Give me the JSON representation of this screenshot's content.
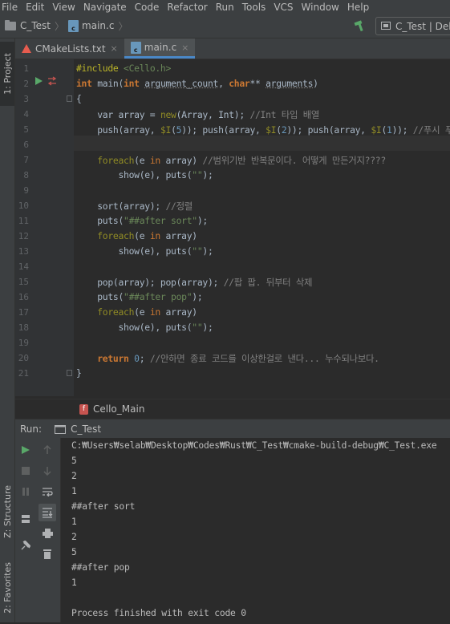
{
  "menu": [
    "File",
    "Edit",
    "View",
    "Navigate",
    "Code",
    "Refactor",
    "Run",
    "Tools",
    "VCS",
    "Window",
    "Help"
  ],
  "nav": {
    "project": "C_Test",
    "file": "main.c",
    "run_config": "C_Test | Deb"
  },
  "left_strip": {
    "project_tab": "1: Project",
    "structure_tab": "Z: Structure",
    "favorites_tab": "2: Favorites"
  },
  "tabs": [
    {
      "label": "CMakeLists.txt",
      "close": "×"
    },
    {
      "label": "main.c",
      "close": "×"
    }
  ],
  "editor": {
    "line_numbers": [
      "1",
      "2",
      "3",
      "4",
      "5",
      "6",
      "7",
      "8",
      "9",
      "10",
      "11",
      "12",
      "13",
      "14",
      "15",
      "16",
      "17",
      "18",
      "19",
      "20",
      "21"
    ],
    "function_breadcrumb": "Cello_Main",
    "lines": [
      [
        {
          "t": "#include ",
          "c": "inc"
        },
        {
          "t": "<Cello.h>",
          "c": "str"
        }
      ],
      [
        {
          "t": "int ",
          "c": "kw"
        },
        {
          "t": "main(",
          "c": ""
        },
        {
          "t": "int ",
          "c": "kw"
        },
        {
          "t": "argument_count",
          "c": "param"
        },
        {
          "t": ", ",
          "c": ""
        },
        {
          "t": "char",
          "c": "kw"
        },
        {
          "t": "** ",
          "c": ""
        },
        {
          "t": "arguments",
          "c": "param"
        },
        {
          "t": ")",
          "c": ""
        }
      ],
      [
        {
          "t": "{",
          "c": ""
        }
      ],
      [
        {
          "t": "    var array = ",
          "c": ""
        },
        {
          "t": "new",
          "c": "mac"
        },
        {
          "t": "(Array, Int); ",
          "c": ""
        },
        {
          "t": "//Int 타입 배열",
          "c": "cm"
        }
      ],
      [
        {
          "t": "    push(array, ",
          "c": ""
        },
        {
          "t": "$I",
          "c": "mac"
        },
        {
          "t": "(",
          "c": ""
        },
        {
          "t": "5",
          "c": "num"
        },
        {
          "t": ")); push(array, ",
          "c": ""
        },
        {
          "t": "$I",
          "c": "mac"
        },
        {
          "t": "(",
          "c": ""
        },
        {
          "t": "2",
          "c": "num"
        },
        {
          "t": ")); push(array, ",
          "c": ""
        },
        {
          "t": "$I",
          "c": "mac"
        },
        {
          "t": "(",
          "c": ""
        },
        {
          "t": "1",
          "c": "num"
        },
        {
          "t": ")); ",
          "c": ""
        },
        {
          "t": "//푸시 푸시",
          "c": "cm"
        }
      ],
      [],
      [
        {
          "t": "    ",
          "c": ""
        },
        {
          "t": "foreach",
          "c": "mac"
        },
        {
          "t": "(e ",
          "c": ""
        },
        {
          "t": "in",
          "c": "kwn"
        },
        {
          "t": " array) ",
          "c": ""
        },
        {
          "t": "//범위기반 반복문이다. 어떻게 만든거지????",
          "c": "cm"
        }
      ],
      [
        {
          "t": "        show(e), puts(",
          "c": ""
        },
        {
          "t": "\"\"",
          "c": "str"
        },
        {
          "t": ");",
          "c": ""
        }
      ],
      [],
      [
        {
          "t": "    sort(array); ",
          "c": ""
        },
        {
          "t": "//정렬",
          "c": "cm"
        }
      ],
      [
        {
          "t": "    puts(",
          "c": ""
        },
        {
          "t": "\"##after sort\"",
          "c": "str"
        },
        {
          "t": ");",
          "c": ""
        }
      ],
      [
        {
          "t": "    ",
          "c": ""
        },
        {
          "t": "foreach",
          "c": "mac"
        },
        {
          "t": "(e ",
          "c": ""
        },
        {
          "t": "in",
          "c": "kwn"
        },
        {
          "t": " array)",
          "c": ""
        }
      ],
      [
        {
          "t": "        show(e), puts(",
          "c": ""
        },
        {
          "t": "\"\"",
          "c": "str"
        },
        {
          "t": ");",
          "c": ""
        }
      ],
      [],
      [
        {
          "t": "    pop(array); pop(array); ",
          "c": ""
        },
        {
          "t": "//팝 팝. 뒤부터 삭제",
          "c": "cm"
        }
      ],
      [
        {
          "t": "    puts(",
          "c": ""
        },
        {
          "t": "\"##after pop\"",
          "c": "str"
        },
        {
          "t": ");",
          "c": ""
        }
      ],
      [
        {
          "t": "    ",
          "c": ""
        },
        {
          "t": "foreach",
          "c": "mac"
        },
        {
          "t": "(e ",
          "c": ""
        },
        {
          "t": "in",
          "c": "kwn"
        },
        {
          "t": " array)",
          "c": ""
        }
      ],
      [
        {
          "t": "        show(e), puts(",
          "c": ""
        },
        {
          "t": "\"\"",
          "c": "str"
        },
        {
          "t": ");",
          "c": ""
        }
      ],
      [],
      [
        {
          "t": "    ",
          "c": ""
        },
        {
          "t": "return ",
          "c": "kw"
        },
        {
          "t": "0",
          "c": "num"
        },
        {
          "t": "; ",
          "c": ""
        },
        {
          "t": "//안하면 종료 코드를 이상한걸로 낸다... 누수되나보다.",
          "c": "cm"
        }
      ],
      [
        {
          "t": "}",
          "c": ""
        }
      ]
    ]
  },
  "run_panel": {
    "label": "Run:",
    "tab": "C_Test",
    "console": [
      "C:₩Users₩selab₩Desktop₩Codes₩Rust₩C_Test₩cmake-build-debug₩C_Test.exe",
      "5",
      "2",
      "1",
      "##after sort",
      "1",
      "2",
      "5",
      "##after pop",
      "1",
      "",
      "Process finished with exit code 0"
    ]
  },
  "colors": {
    "keyword": "#cc7832",
    "comment": "#808080",
    "string": "#6a8759",
    "number": "#6897bb",
    "macro": "#908b25",
    "run_green": "#59a869"
  }
}
